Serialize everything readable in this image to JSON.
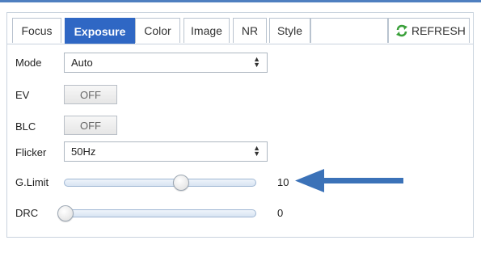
{
  "tabs": [
    {
      "label": "Focus",
      "active": false
    },
    {
      "label": "Exposure",
      "active": true
    },
    {
      "label": "Color",
      "active": false
    },
    {
      "label": "Image",
      "active": false
    },
    {
      "label": "NR",
      "active": false
    },
    {
      "label": "Style",
      "active": false
    }
  ],
  "refresh": {
    "label": "REFRESH",
    "icon": "refresh-icon",
    "icon_color": "#3aa03a"
  },
  "accent_color": "#2f67c4",
  "settings": {
    "mode": {
      "label": "Mode",
      "value": "Auto"
    },
    "ev": {
      "label": "EV",
      "button": "OFF"
    },
    "blc": {
      "label": "BLC",
      "button": "OFF"
    },
    "flicker": {
      "label": "Flicker",
      "value": "50Hz"
    },
    "glimit": {
      "label": "G.Limit",
      "value": "10",
      "level": 0.61
    },
    "drc": {
      "label": "DRC",
      "value": "0",
      "level": 0.0
    }
  },
  "annotation": {
    "icon": "arrow-left-icon",
    "color": "#3b72b8"
  }
}
